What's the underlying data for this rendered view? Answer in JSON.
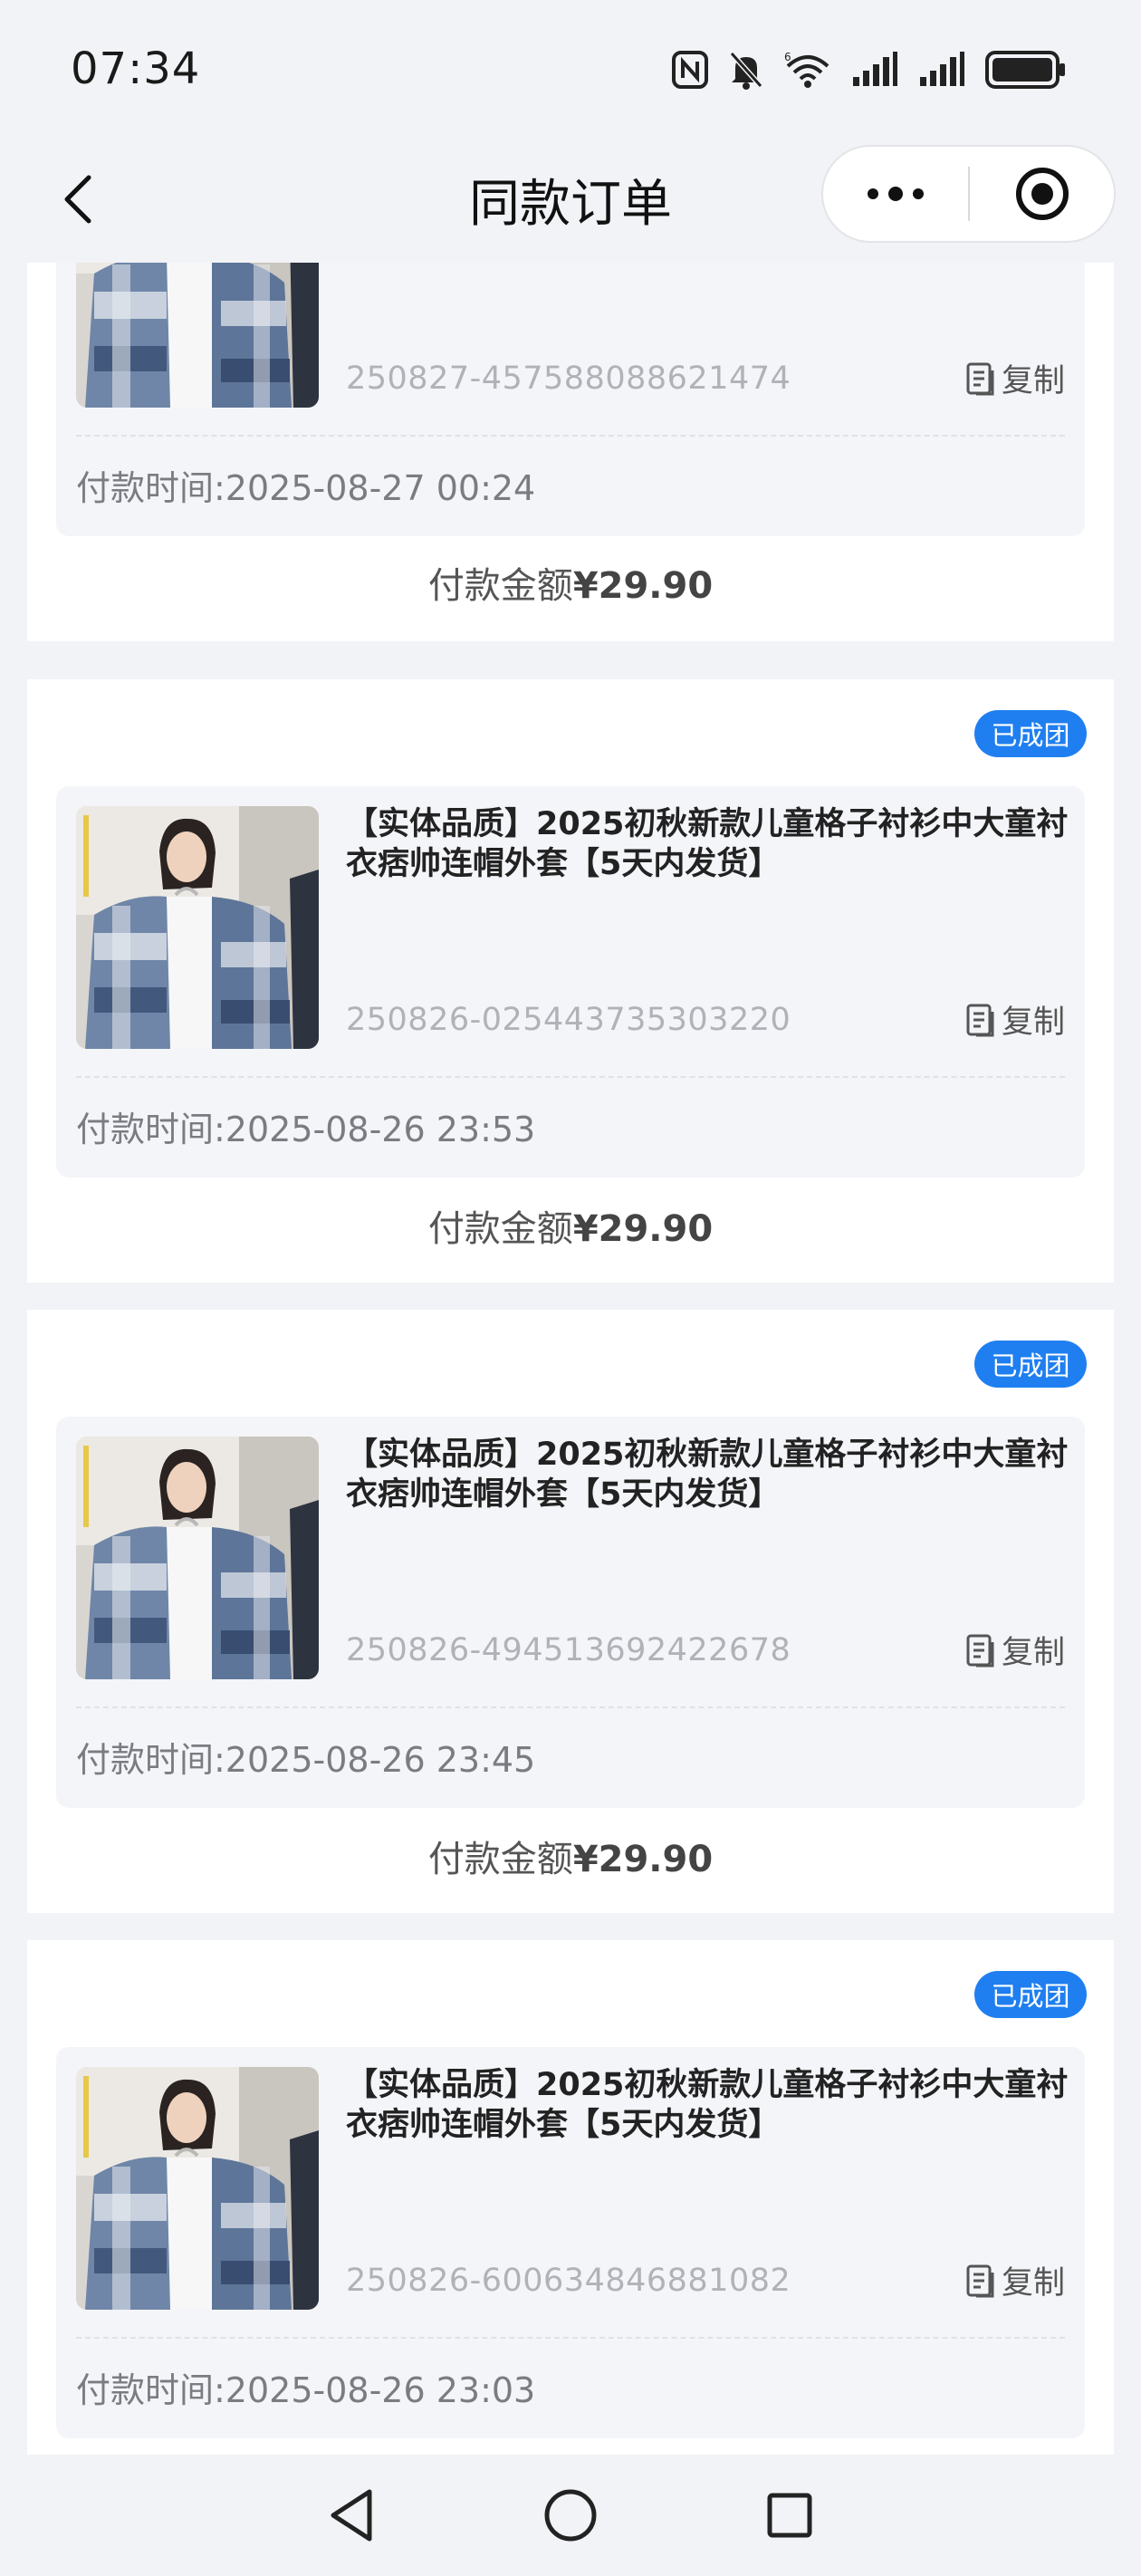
{
  "status_bar": {
    "time": "07:34",
    "icons": [
      "nfc-icon",
      "mute-icon",
      "wifi-icon",
      "signal-icon",
      "signal-icon",
      "battery-icon"
    ],
    "wifi_label": "6"
  },
  "nav": {
    "title": "同款订单",
    "back_icon": "chevron-left-icon",
    "more_icon": "more-dots-icon",
    "close_icon": "target-icon"
  },
  "orders": [
    {
      "title": "",
      "order_no": "250827-457588088621474",
      "copy_label": "复制",
      "pay_time": "付款时间:2025-08-27 00:24",
      "amount_label": "付款金额",
      "amount": "¥29.90"
    },
    {
      "status": "已成团",
      "title": "【实体品质】2025初秋新款儿童格子衬衫中大童衬衣痞帅连帽外套【5天内发货】",
      "order_no": "250826-025443735303220",
      "copy_label": "复制",
      "pay_time": "付款时间:2025-08-26 23:53",
      "amount_label": "付款金额",
      "amount": "¥29.90"
    },
    {
      "status": "已成团",
      "title": "【实体品质】2025初秋新款儿童格子衬衫中大童衬衣痞帅连帽外套【5天内发货】",
      "order_no": "250826-494513692422678",
      "copy_label": "复制",
      "pay_time": "付款时间:2025-08-26 23:45",
      "amount_label": "付款金额",
      "amount": "¥29.90"
    },
    {
      "status": "已成团",
      "title": "【实体品质】2025初秋新款儿童格子衬衫中大童衬衣痞帅连帽外套【5天内发货】",
      "order_no": "250826-600634846881082",
      "copy_label": "复制",
      "pay_time": "付款时间:2025-08-26 23:03"
    }
  ],
  "system_nav": {
    "back_icon": "triangle-back-icon",
    "home_icon": "circle-home-icon",
    "recents_icon": "square-recents-icon"
  },
  "colors": {
    "badge": "#1f7ff0",
    "background": "#f2f3f7"
  }
}
